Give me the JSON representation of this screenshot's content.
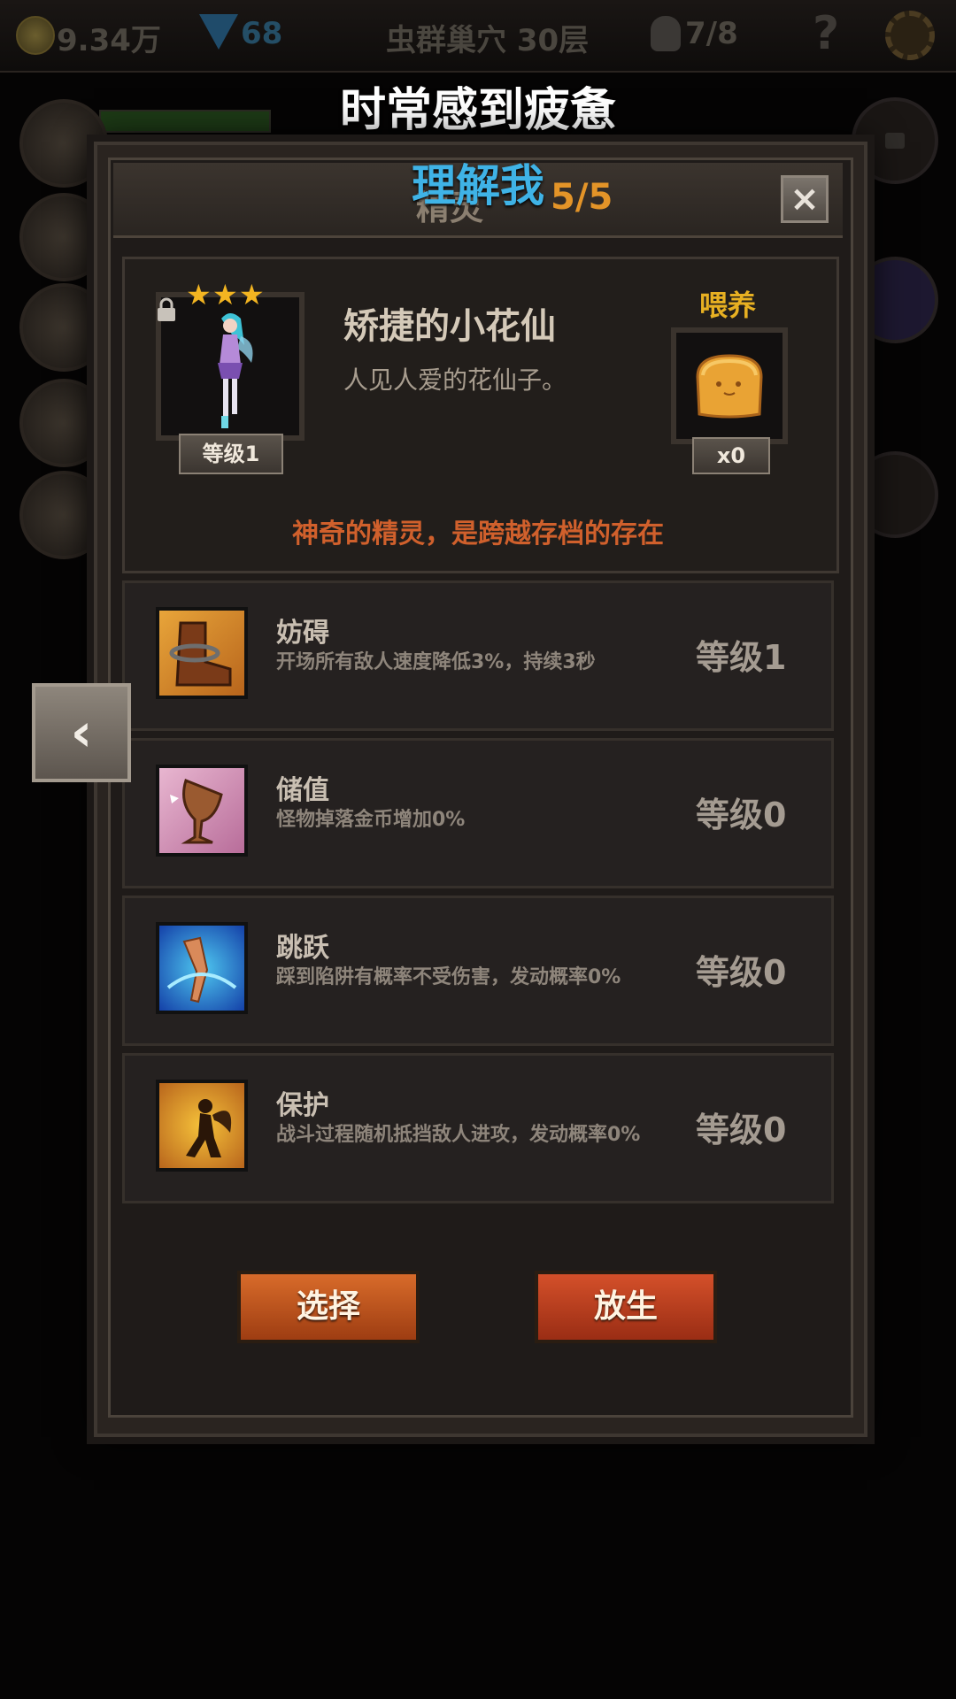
{
  "topbar": {
    "gold": "9.34万",
    "gems": "68",
    "stage": "虫群巢穴 30层",
    "skulls": "7/8",
    "help": "?"
  },
  "overlay": {
    "title": "时常感到疲惫",
    "subtitle": "理解我"
  },
  "panel": {
    "title": "精灵",
    "count": "5/5",
    "close": "×"
  },
  "fairy": {
    "stars": 3,
    "level_label": "等级1",
    "name": "矫捷的小花仙",
    "description": "人见人爱的花仙子。",
    "feed_label": "喂养",
    "feed_count": "x0",
    "slogan": "神奇的精灵，是跨越存档的存在"
  },
  "skills": [
    {
      "name": "妨碍",
      "desc": "开场所有敌人速度降低3%，持续3秒",
      "level": "等级1",
      "icon": "boot-chain-icon"
    },
    {
      "name": "储值",
      "desc": "怪物掉落金币增加0%",
      "level": "等级0",
      "icon": "goblet-icon"
    },
    {
      "name": "跳跃",
      "desc": "踩到陷阱有概率不受伤害，发动概率0%",
      "level": "等级0",
      "icon": "leaping-leg-icon"
    },
    {
      "name": "保护",
      "desc": "战斗过程随机抵挡敌人进攻，发动概率0%",
      "level": "等级0",
      "icon": "fairy-silhouette-icon"
    }
  ],
  "nav": {
    "back": "‹"
  },
  "buttons": {
    "select": "选择",
    "release": "放生"
  },
  "colors": {
    "accent_orange": "#e39428",
    "feed_gold": "#e7b022",
    "slogan": "#d0602c",
    "overlay_blue": "#3fb3e6"
  }
}
